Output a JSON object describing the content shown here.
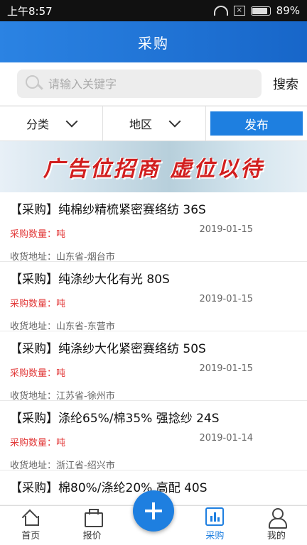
{
  "status_bar": {
    "time": "上午8:57",
    "battery": "89%",
    "battery_level": 0.89
  },
  "app_bar": {
    "title": "采购"
  },
  "search": {
    "placeholder": "请输入关键字",
    "value": "",
    "button": "搜索"
  },
  "filters": {
    "category": "分类",
    "region": "地区",
    "publish": "发布"
  },
  "banner": {
    "text": "广告位招商  虚位以待"
  },
  "items": [
    {
      "title": "【采购】纯棉纱精梳紧密赛络纺 36S",
      "qty": "采购数量：吨",
      "date": "2019-01-15",
      "address": "收货地址：山东省-烟台市"
    },
    {
      "title": "【采购】纯涤纱大化有光 80S",
      "qty": "采购数量：吨",
      "date": "2019-01-15",
      "address": "收货地址：山东省-东营市"
    },
    {
      "title": "【采购】纯涤纱大化紧密赛络纺 50S",
      "qty": "采购数量：吨",
      "date": "2019-01-15",
      "address": "收货地址：江苏省-徐州市"
    },
    {
      "title": "【采购】涤纶65%/棉35% 强捻纱 24S",
      "qty": "采购数量：吨",
      "date": "2019-01-14",
      "address": "收货地址：浙江省-绍兴市"
    },
    {
      "title": "【采购】棉80%/涤纶20% 高配 40S",
      "qty": "",
      "date": "",
      "address": ""
    }
  ],
  "tabs": [
    {
      "label": "首页",
      "icon": "home-icon"
    },
    {
      "label": "报价",
      "icon": "briefcase-icon"
    },
    {
      "label": "采购",
      "icon": "bar-chart-icon",
      "active": true
    },
    {
      "label": "我的",
      "icon": "person-icon"
    }
  ],
  "colors": {
    "primary": "#1e7fe0",
    "accent_red": "#e23a3a"
  }
}
